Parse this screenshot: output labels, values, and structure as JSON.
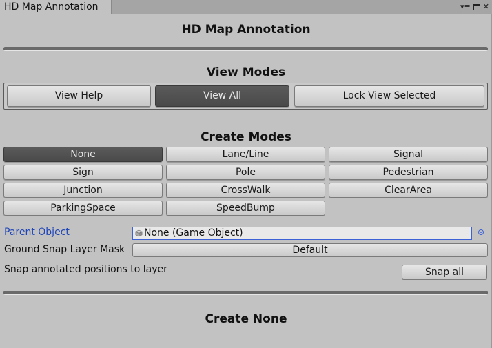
{
  "window": {
    "tab_title": "HD Map Annotation",
    "menu_glyph": "▾≡"
  },
  "header": {
    "title": "HD Map Annotation"
  },
  "view_modes": {
    "heading": "View Modes",
    "buttons": [
      {
        "label": "View Help",
        "selected": false
      },
      {
        "label": "View All",
        "selected": true
      },
      {
        "label": "Lock View Selected",
        "selected": false
      }
    ]
  },
  "create_modes": {
    "heading": "Create Modes",
    "buttons": [
      {
        "label": "None",
        "selected": true
      },
      {
        "label": "Lane/Line",
        "selected": false
      },
      {
        "label": "Signal",
        "selected": false
      },
      {
        "label": "Sign",
        "selected": false
      },
      {
        "label": "Pole",
        "selected": false
      },
      {
        "label": "Pedestrian",
        "selected": false
      },
      {
        "label": "Junction",
        "selected": false
      },
      {
        "label": "CrossWalk",
        "selected": false
      },
      {
        "label": "ClearArea",
        "selected": false
      },
      {
        "label": "ParkingSpace",
        "selected": false
      },
      {
        "label": "SpeedBump",
        "selected": false
      }
    ]
  },
  "fields": {
    "parent_object_label": "Parent Object",
    "parent_object_value": "None (Game Object)",
    "ground_snap_label": "Ground Snap Layer Mask",
    "ground_snap_value": "Default",
    "snap_label": "Snap annotated positions to layer",
    "snap_all_button": "Snap all"
  },
  "footer": {
    "title": "Create None"
  },
  "colors": {
    "panel_bg": "#c2c2c2",
    "selected_button": "#4f4f4f",
    "field_focus_border": "#3c61d6",
    "label_blue": "#1f45b8"
  }
}
